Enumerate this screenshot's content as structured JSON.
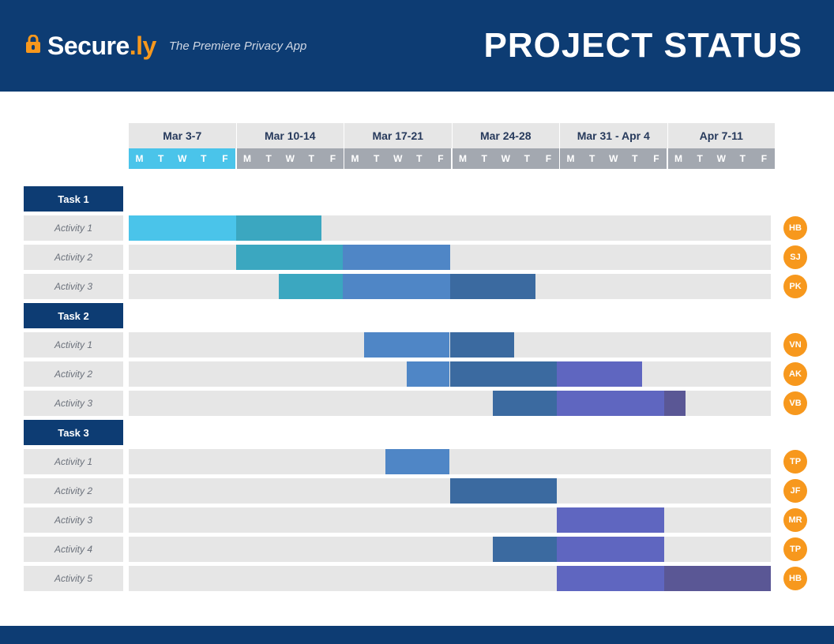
{
  "header": {
    "logo_secure": "Secure",
    "logo_dot": ".",
    "logo_ly": "ly",
    "tagline": "The Premiere Privacy App",
    "title": "PROJECT STATUS"
  },
  "weeks": [
    {
      "label": "Mar 3-7",
      "highlight": true
    },
    {
      "label": "Mar 10-14",
      "highlight": false
    },
    {
      "label": "Mar 17-21",
      "highlight": false
    },
    {
      "label": "Mar 24-28",
      "highlight": false
    },
    {
      "label": "Mar 31 - Apr 4",
      "highlight": false
    },
    {
      "label": "Apr 7-11",
      "highlight": false
    }
  ],
  "days": [
    "M",
    "T",
    "W",
    "T",
    "F"
  ],
  "chart_data": {
    "type": "gantt",
    "x_unit": "day_index_0_to_29",
    "columns_per_week": 5,
    "weeks": [
      "Mar 3-7",
      "Mar 10-14",
      "Mar 17-21",
      "Mar 24-28",
      "Mar 31 - Apr 4",
      "Apr 7-11"
    ],
    "day_labels": [
      "M",
      "T",
      "W",
      "T",
      "F"
    ],
    "colors": {
      "c1": "#4ac4ea",
      "c2": "#3ba7c0",
      "c3": "#4f86c6",
      "c4": "#3b6aa0",
      "c5": "#5f66c0",
      "c6": "#5a5795"
    },
    "tasks": [
      {
        "name": "Task 1",
        "activities": [
          {
            "name": "Activity 1",
            "assignee": "HB",
            "bars": [
              {
                "start": 0,
                "end": 5,
                "color": "c1"
              },
              {
                "start": 5,
                "end": 9,
                "color": "c2"
              }
            ]
          },
          {
            "name": "Activity 2",
            "assignee": "SJ",
            "bars": [
              {
                "start": 5,
                "end": 10,
                "color": "c2"
              },
              {
                "start": 10,
                "end": 15,
                "color": "c3"
              }
            ]
          },
          {
            "name": "Activity 3",
            "assignee": "PK",
            "bars": [
              {
                "start": 7,
                "end": 10,
                "color": "c2"
              },
              {
                "start": 10,
                "end": 15,
                "color": "c3"
              },
              {
                "start": 15,
                "end": 19,
                "color": "c4"
              }
            ]
          }
        ]
      },
      {
        "name": "Task 2",
        "activities": [
          {
            "name": "Activity 1",
            "assignee": "VN",
            "bars": [
              {
                "start": 11,
                "end": 15,
                "color": "c3"
              },
              {
                "start": 15,
                "end": 18,
                "color": "c4"
              }
            ]
          },
          {
            "name": "Activity 2",
            "assignee": "AK",
            "bars": [
              {
                "start": 13,
                "end": 15,
                "color": "c3"
              },
              {
                "start": 15,
                "end": 20,
                "color": "c4"
              },
              {
                "start": 20,
                "end": 24,
                "color": "c5"
              }
            ]
          },
          {
            "name": "Activity 3",
            "assignee": "VB",
            "bars": [
              {
                "start": 17,
                "end": 20,
                "color": "c4"
              },
              {
                "start": 20,
                "end": 25,
                "color": "c5"
              },
              {
                "start": 25,
                "end": 26,
                "color": "c6"
              }
            ]
          }
        ]
      },
      {
        "name": "Task 3",
        "activities": [
          {
            "name": "Activity 1",
            "assignee": "TP",
            "bars": [
              {
                "start": 12,
                "end": 15,
                "color": "c3"
              }
            ]
          },
          {
            "name": "Activity 2",
            "assignee": "JF",
            "bars": [
              {
                "start": 15,
                "end": 20,
                "color": "c4"
              }
            ]
          },
          {
            "name": "Activity 3",
            "assignee": "MR",
            "bars": [
              {
                "start": 20,
                "end": 25,
                "color": "c5"
              }
            ]
          },
          {
            "name": "Activity 4",
            "assignee": "TP",
            "bars": [
              {
                "start": 17,
                "end": 20,
                "color": "c4"
              },
              {
                "start": 20,
                "end": 25,
                "color": "c5"
              }
            ]
          },
          {
            "name": "Activity 5",
            "assignee": "HB",
            "bars": [
              {
                "start": 20,
                "end": 25,
                "color": "c5"
              },
              {
                "start": 25,
                "end": 30,
                "color": "c6"
              }
            ]
          }
        ]
      }
    ]
  }
}
